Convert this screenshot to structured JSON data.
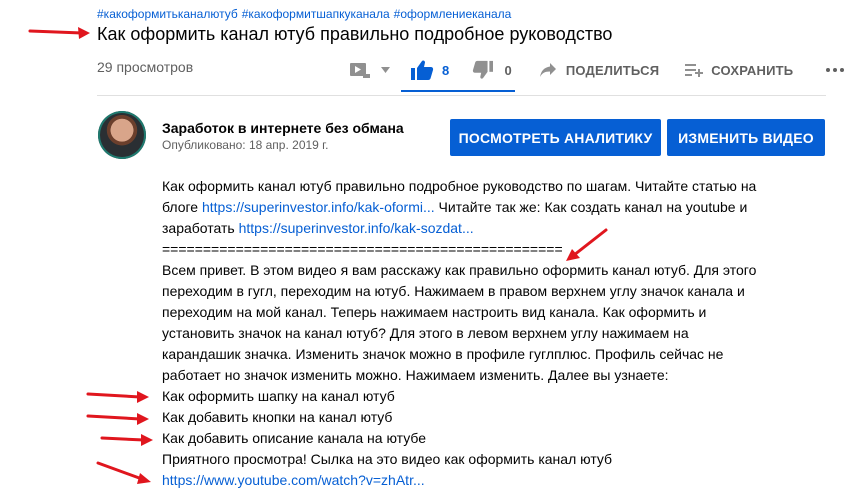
{
  "hashtags": [
    "#какоформитьканалютуб",
    "#какоформитшапкуканала",
    "#оформлениеканала"
  ],
  "video": {
    "title": "Как оформить канал ютуб правильно подробное руководство",
    "views": "29 просмотров"
  },
  "actions": {
    "like_count": "8",
    "dislike_count": "0",
    "share_label": "ПОДЕЛИТЬСЯ",
    "save_label": "СОХРАНИТЬ",
    "like_ratio": 1.0
  },
  "channel": {
    "name": "Заработок в интернете без обмана",
    "published": "Опубликовано: 18 апр. 2019 г."
  },
  "buttons": {
    "analytics": "ПОСМОТРЕТЬ АНАЛИТИКУ",
    "edit": "ИЗМЕНИТЬ ВИДЕО"
  },
  "description": {
    "l1": "Как оформить канал ютуб правильно   подробное руководство по шагам. Читайте статью на",
    "l2_pre": "блоге ",
    "l2_link": "https://superinvestor.info/kak-oformi...",
    "l2_post": " Читайте так же: Как создать канал на youtube и",
    "l3_pre": "заработать ",
    "l3_link": "https://superinvestor.info/kak-sozdat...",
    "l4": "=================================================",
    "l5": "Всем привет. В этом видео я вам расскажу как правильно оформить канал ютуб. Для этого",
    "l6": "переходим в гугл, переходим на ютуб. Нажимаем в правом верхнем углу значок канала и",
    "l7": "переходим на мой канал. Теперь нажимаем настроить вид канала. Как оформить и",
    "l8": "установить значок на канал ютуб? Для этого в левом верхнем углу нажимаем на",
    "l9": "карандашик значка. Изменить значок можно в профиле гуглплюс. Профиль сейчас не",
    "l10": "работает но значок изменить можно. Нажимаем изменить. Далее вы узнаете:",
    "l11": "Как оформить шапку на канал ютуб",
    "l12": "Как добавить кнопки на канал ютуб",
    "l13": "Как добавить описание канала на ютубе",
    "l14": "Приятного просмотра! Сылка на это видео как оформить канал ютуб",
    "l15_link": "https://www.youtube.com/watch?v=zhAtr..."
  },
  "colors": {
    "accent": "#065fd4",
    "annotation_arrow": "#e0161e"
  }
}
